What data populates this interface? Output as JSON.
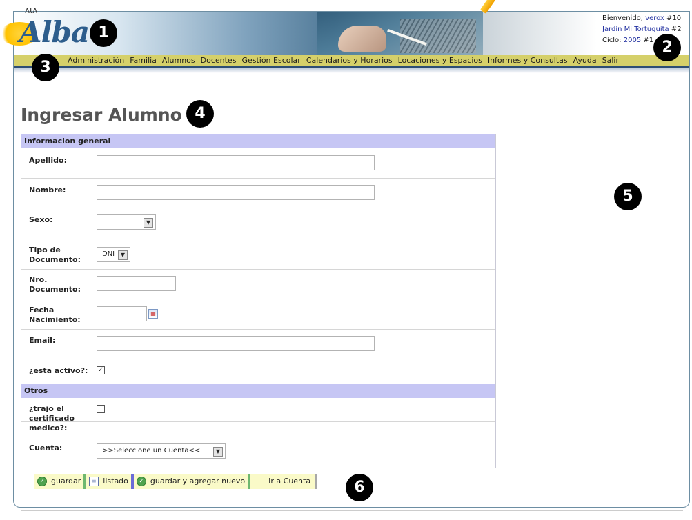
{
  "header": {
    "logo_text": "Alba",
    "welcome_prefix": "Bienvenido,",
    "user": "verox",
    "user_num": "#10",
    "school": "Jardín Mi Tortuguita",
    "school_num": "#2",
    "cycle_prefix": "Ciclo:",
    "cycle": "2005",
    "cycle_num": "#1"
  },
  "nav": {
    "items": [
      "Administración",
      "Familia",
      "Alumnos",
      "Docentes",
      "Gestión Escolar",
      "Calendarios y Horarios",
      "Locaciones y Espacios",
      "Informes y Consultas",
      "Ayuda",
      "Salir"
    ]
  },
  "page": {
    "title": "Ingresar Alumno"
  },
  "form": {
    "section_general": "Informacion general",
    "apellido_label": "Apellido:",
    "apellido_value": "",
    "nombre_label": "Nombre:",
    "nombre_value": "",
    "sexo_label": "Sexo:",
    "sexo_value": "",
    "tipo_doc_label_1": "Tipo de",
    "tipo_doc_label_2": "Documento:",
    "tipo_doc_value": "DNI",
    "nro_doc_label_1": "Nro.",
    "nro_doc_label_2": "Documento:",
    "nro_doc_value": "",
    "fecha_label_1": "Fecha",
    "fecha_label_2": "Nacimiento:",
    "fecha_value": "",
    "email_label": "Email:",
    "email_value": "",
    "activo_label": "¿esta activo?:",
    "activo_checked": true,
    "section_otros": "Otros",
    "cert_label_1": "¿trajo el",
    "cert_label_2": "certificado",
    "cert_label_3": "medico?:",
    "cert_checked": false,
    "cuenta_label": "Cuenta:",
    "cuenta_value": ">>Seleccione un Cuenta<<"
  },
  "actions": {
    "guardar": "guardar",
    "listado": "listado",
    "guardar_nuevo": "guardar y agregar nuevo",
    "ir_cuenta": "Ir a Cuenta"
  },
  "markers": [
    "1",
    "2",
    "3",
    "4",
    "5",
    "6"
  ],
  "colors": {
    "nav_bg": "#d5d06a",
    "section_bg": "#c6c6f4",
    "button_bg": "#fafac8",
    "link": "#2130a0"
  }
}
